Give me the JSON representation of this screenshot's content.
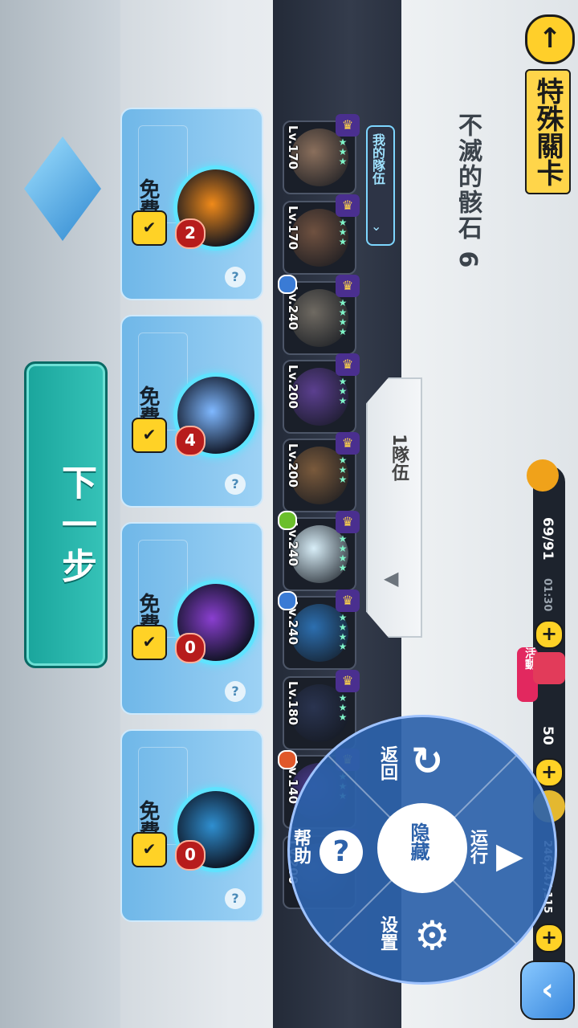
{
  "header": {
    "title": "特殊關卡",
    "stage_name": "不滅的骸石 6",
    "back_icon": "arrow-back-icon"
  },
  "team": {
    "my_team_label": "我的隊伍",
    "team_tab_label": "1隊伍"
  },
  "roster": [
    {
      "level": "Lv.170",
      "stars": "★★★★",
      "color": "#8a6f5c"
    },
    {
      "level": "Lv.170",
      "stars": "★★★★",
      "color": "#6f5140"
    },
    {
      "level": "Lv.240",
      "stars": "★★★★★",
      "color": "#6f6a62"
    },
    {
      "level": "Lv.200",
      "stars": "★★★★",
      "color": "#5b3f8f"
    },
    {
      "level": "Lv.200",
      "stars": "★★★★",
      "color": "#7a5a3c"
    },
    {
      "level": "Lv.240",
      "stars": "★★★★★",
      "color": "#d8eef8"
    },
    {
      "level": "Lv.240",
      "stars": "★★★★★",
      "color": "#2c6fb0"
    },
    {
      "level": "Lv.180",
      "stars": "★★★★",
      "color": "#2a3450"
    },
    {
      "level": "Lv.140",
      "stars": "★★★★",
      "color": "#4b3c8f"
    },
    {
      "level": "Lv.200",
      "stars": "★★★",
      "color": "#3f4f7a"
    }
  ],
  "resources": {
    "stamina": "69/91",
    "stamina_timer": "01:30",
    "gems": "50",
    "gold": "246,247,115",
    "event_label": "活動",
    "plus": "+"
  },
  "skills": [
    {
      "free_label": "免費",
      "count": "2",
      "orb_color": "#f08a1a",
      "check": "✔"
    },
    {
      "free_label": "免費",
      "count": "4",
      "orb_color": "#7fb8ff",
      "check": "✔"
    },
    {
      "free_label": "免費",
      "count": "0",
      "orb_color": "#8a3fd0",
      "check": "✔"
    },
    {
      "free_label": "免費",
      "count": "0",
      "orb_color": "#2f8fd0",
      "check": "✔"
    }
  ],
  "next_button": "下一步",
  "radial_menu": {
    "hide": "隐藏",
    "back": "返回",
    "run": "运行",
    "settings": "设置",
    "help": "帮助"
  },
  "help_mark": "?",
  "corner_button_icon": "chevron-left-icon",
  "corner_button_glyph": "‹"
}
